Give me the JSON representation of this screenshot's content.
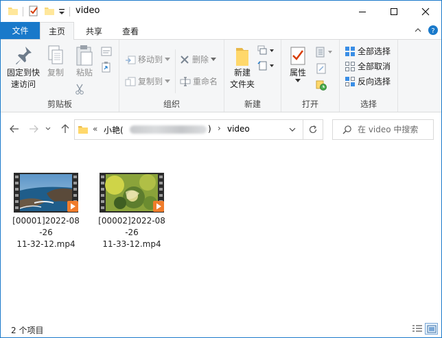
{
  "window": {
    "title": "video"
  },
  "ribbon_tabs": {
    "file": "文件",
    "home": "主页",
    "share": "共享",
    "view": "查看"
  },
  "clipboard": {
    "pin": "固定到快",
    "pin2": "速访问",
    "copy": "复制",
    "paste": "粘贴",
    "label": "剪贴板"
  },
  "organize": {
    "move_to": "移动到",
    "copy_to": "复制到",
    "delete": "删除",
    "rename": "重命名",
    "label": "组织"
  },
  "new": {
    "new_folder": "新建",
    "new_folder2": "文件夹",
    "label": "新建"
  },
  "open": {
    "properties": "属性",
    "label": "打开"
  },
  "select": {
    "select_all": "全部选择",
    "select_none": "全部取消",
    "invert": "反向选择",
    "label": "选择"
  },
  "address": {
    "prefix": "«",
    "crumb_user": "小艳(",
    "crumb_user_close": ")",
    "sep": "›",
    "crumb_folder": "video"
  },
  "search": {
    "placeholder": "在 video 中搜索"
  },
  "files": [
    {
      "line1": "[00001]2022-08",
      "line2": "-26",
      "line3": "11-32-12.mp4"
    },
    {
      "line1": "[00002]2022-08",
      "line2": "-26",
      "line3": "11-33-12.mp4"
    }
  ],
  "status": {
    "count": "2 个项目"
  },
  "colors": {
    "accent": "#1979ca",
    "ribbon_bg": "#f5f6f7",
    "disabled_text": "#8e8e8e"
  }
}
